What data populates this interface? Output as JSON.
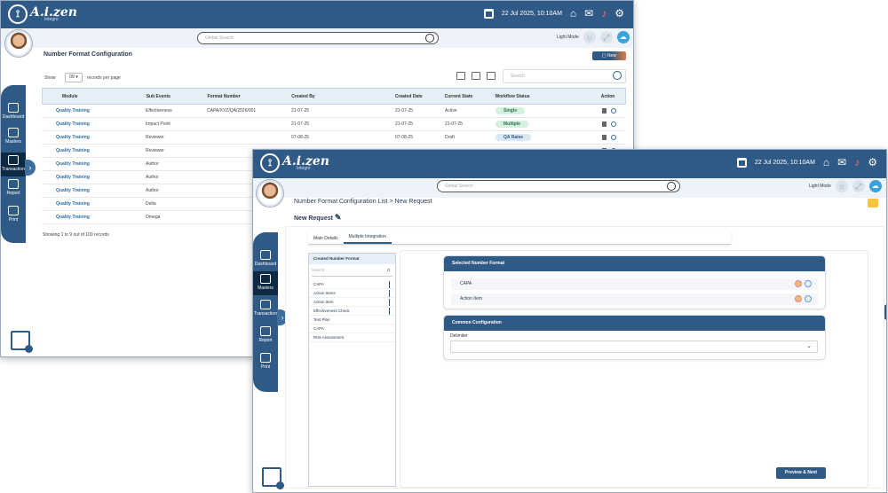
{
  "brand": {
    "logo_text": "A.i.zen",
    "logo_sub": "Integro"
  },
  "topbar": {
    "datetime": "22 Jul 2025, 10:10AM"
  },
  "search": {
    "placeholder": "Global Search"
  },
  "light_mode_label": "Light Mode",
  "nav": [
    "Dashboard",
    "Masters",
    "Transaction",
    "Report",
    "Print"
  ],
  "list_window": {
    "title": "Number Format Configuration",
    "new_button": "New",
    "show_label": "Show",
    "show_value": "09",
    "records_per_page": "records per page",
    "search_placeholder": "Search",
    "columns": [
      "Module",
      "Sub Events",
      "Format Number",
      "Created By",
      "Created Date",
      "Current State",
      "Workflow Status",
      "Action"
    ],
    "rows": [
      {
        "module": "Quality Training",
        "sub_event": "Effectiveness",
        "format": "CAPA/XYZ/QA/2026/001",
        "created_by": "21-07-25",
        "created_date": "21-07-25",
        "state": "Active",
        "status": "Single",
        "status_color": "green"
      },
      {
        "module": "Quality Training",
        "sub_event": "Impact Point",
        "format": "",
        "created_by": "21-07-25",
        "created_date": "21-07-25",
        "state": "21-07-25",
        "status": "Multiple",
        "status_color": "green"
      },
      {
        "module": "Quality Training",
        "sub_event": "Reviewer",
        "format": "",
        "created_by": "07-08-25",
        "created_date": "07-08-25",
        "state": "Draft",
        "status": "QA Raise",
        "status_color": "blue"
      },
      {
        "module": "Quality Training",
        "sub_event": "Reviewer",
        "format": "",
        "created_by": "",
        "created_date": "",
        "state": "",
        "status": "",
        "status_color": ""
      },
      {
        "module": "Quality Training",
        "sub_event": "Author",
        "format": "",
        "created_by": "",
        "created_date": "",
        "state": "",
        "status": "",
        "status_color": ""
      },
      {
        "module": "Quality Training",
        "sub_event": "Author",
        "format": "",
        "created_by": "",
        "created_date": "",
        "state": "",
        "status": "",
        "status_color": ""
      },
      {
        "module": "Quality Training",
        "sub_event": "Author",
        "format": "",
        "created_by": "",
        "created_date": "",
        "state": "",
        "status": "",
        "status_color": ""
      },
      {
        "module": "Quality Training",
        "sub_event": "Delta",
        "format": "",
        "created_by": "",
        "created_date": "",
        "state": "",
        "status": "",
        "status_color": ""
      },
      {
        "module": "Quality Training",
        "sub_event": "Omega",
        "format": "",
        "created_by": "",
        "created_date": "",
        "state": "",
        "status": "",
        "status_color": ""
      }
    ],
    "footer": "Showing 1 to 9 out of 100 records"
  },
  "request_window": {
    "breadcrumb_1": "Number Format Configuration",
    "breadcrumb_2": "List",
    "breadcrumb_sep": ">",
    "breadcrumb_3": "New Request",
    "page_title": "New Request",
    "tabs": [
      "Main Details",
      "Multiple Integration"
    ],
    "list_header": "Created Number Format",
    "list_search_placeholder": "Search",
    "list_items": [
      "CAPA",
      "Action Items",
      "Action Item",
      "Effectiveness Check",
      "Test Plan",
      "CAPA",
      "Risk Assessment"
    ],
    "selected_title": "Selected Number Format",
    "selected_items": [
      "CAPA",
      "Action Item"
    ],
    "common_title": "Common Configuration",
    "delimiter_label": "Delimiter",
    "preview_button": "Preview & Next"
  },
  "colors": {
    "primary": "#2f5a85",
    "accent": "#e07a3c",
    "status_green": "#d5efe0"
  }
}
